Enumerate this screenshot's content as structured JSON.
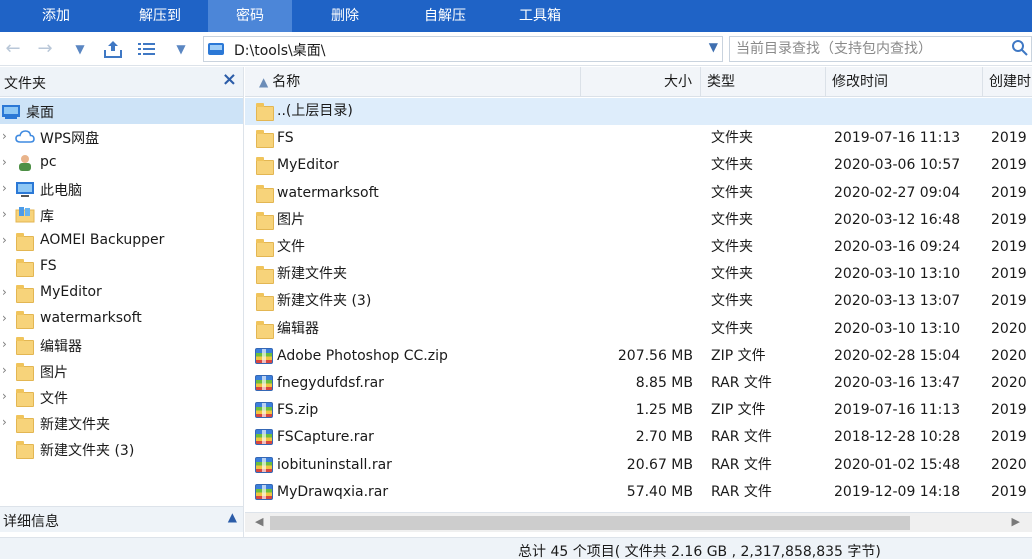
{
  "ribbon": {
    "items": [
      {
        "label": "添加"
      },
      {
        "label": "解压到"
      },
      {
        "label": "密码",
        "active": true
      },
      {
        "label": "删除"
      },
      {
        "label": "自解压"
      },
      {
        "label": "工具箱"
      }
    ]
  },
  "address": {
    "path": "D:\\tools\\桌面\\"
  },
  "search": {
    "placeholder": "当前目录查找（支持包内查找）"
  },
  "folder_pane": {
    "title": "文件夹",
    "items": [
      {
        "label": "桌面",
        "icon": "desktop-icon",
        "selected": true
      },
      {
        "label": "WPS网盘",
        "icon": "cloud-icon"
      },
      {
        "label": "pc",
        "icon": "user-icon"
      },
      {
        "label": "此电脑",
        "icon": "computer-icon"
      },
      {
        "label": "库",
        "icon": "library-icon"
      },
      {
        "label": "AOMEI Backupper",
        "icon": "folder-icon"
      },
      {
        "label": "FS",
        "icon": "folder-icon"
      },
      {
        "label": "MyEditor",
        "icon": "folder-icon"
      },
      {
        "label": "watermarksoft",
        "icon": "folder-icon"
      },
      {
        "label": "编辑器",
        "icon": "folder-icon"
      },
      {
        "label": "图片",
        "icon": "folder-icon"
      },
      {
        "label": "文件",
        "icon": "folder-icon"
      },
      {
        "label": "新建文件夹",
        "icon": "folder-icon"
      },
      {
        "label": "新建文件夹 (3)",
        "icon": "folder-icon"
      }
    ],
    "details_label": "详细信息"
  },
  "columns": {
    "name": "名称",
    "size": "大小",
    "type": "类型",
    "modified": "修改时间",
    "created": "创建时"
  },
  "files": [
    {
      "name": "..(上层目录)",
      "size": "",
      "type": "",
      "modified": "",
      "created": "",
      "icon": "folder-icon",
      "selected": true
    },
    {
      "name": "FS",
      "size": "",
      "type": "文件夹",
      "modified": "2019-07-16 11:13",
      "created": "2019",
      "icon": "folder-icon"
    },
    {
      "name": "MyEditor",
      "size": "",
      "type": "文件夹",
      "modified": "2020-03-06 10:57",
      "created": "2019",
      "icon": "folder-icon"
    },
    {
      "name": "watermarksoft",
      "size": "",
      "type": "文件夹",
      "modified": "2020-02-27 09:04",
      "created": "2019",
      "icon": "folder-icon"
    },
    {
      "name": "图片",
      "size": "",
      "type": "文件夹",
      "modified": "2020-03-12 16:48",
      "created": "2019",
      "icon": "folder-icon"
    },
    {
      "name": "文件",
      "size": "",
      "type": "文件夹",
      "modified": "2020-03-16 09:24",
      "created": "2019",
      "icon": "folder-icon"
    },
    {
      "name": "新建文件夹",
      "size": "",
      "type": "文件夹",
      "modified": "2020-03-10 13:10",
      "created": "2019",
      "icon": "folder-icon"
    },
    {
      "name": "新建文件夹 (3)",
      "size": "",
      "type": "文件夹",
      "modified": "2020-03-13 13:07",
      "created": "2019",
      "icon": "folder-icon"
    },
    {
      "name": "编辑器",
      "size": "",
      "type": "文件夹",
      "modified": "2020-03-10 13:10",
      "created": "2020",
      "icon": "folder-icon"
    },
    {
      "name": "Adobe Photoshop CC.zip",
      "size": "207.56 MB",
      "type": "ZIP 文件",
      "modified": "2020-02-28 15:04",
      "created": "2020",
      "icon": "archive-icon"
    },
    {
      "name": "fnegydufdsf.rar",
      "size": "8.85 MB",
      "type": "RAR 文件",
      "modified": "2020-03-16 13:47",
      "created": "2020",
      "icon": "archive-icon"
    },
    {
      "name": "FS.zip",
      "size": "1.25 MB",
      "type": "ZIP 文件",
      "modified": "2019-07-16 11:13",
      "created": "2019",
      "icon": "archive-icon"
    },
    {
      "name": "FSCapture.rar",
      "size": "2.70 MB",
      "type": "RAR 文件",
      "modified": "2018-12-28 10:28",
      "created": "2019",
      "icon": "archive-icon"
    },
    {
      "name": "iobituninstall.rar",
      "size": "20.67 MB",
      "type": "RAR 文件",
      "modified": "2020-01-02 15:48",
      "created": "2020",
      "icon": "archive-icon"
    },
    {
      "name": "MyDrawqxia.rar",
      "size": "57.40 MB",
      "type": "RAR 文件",
      "modified": "2019-12-09 14:18",
      "created": "2019",
      "icon": "archive-icon"
    }
  ],
  "status": {
    "text": "总计 45 个项目( 文件共 2.16 GB , 2,317,858,835 字节)"
  },
  "colors": {
    "ribbon": "#1f63c6",
    "ribbon_active": "#4c86d8",
    "selection": "#cde3f7"
  }
}
